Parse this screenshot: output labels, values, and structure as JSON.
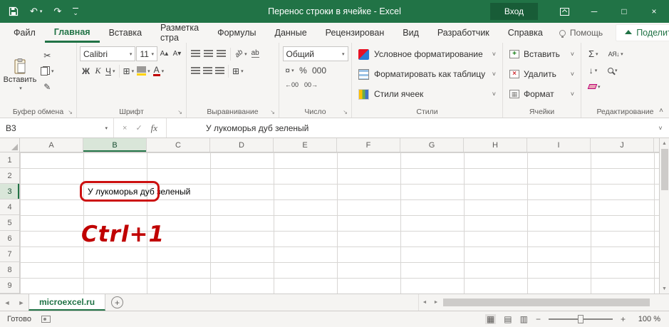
{
  "title_bar": {
    "title": "Перенос строки в ячейке  -  Excel",
    "sign_in": "Вход"
  },
  "icons": {
    "dropdown": "▾",
    "chevron": "˅",
    "collapse": "˄",
    "launcher": "↘",
    "undo": "↶",
    "redo": "↷",
    "qat_more": "⌄",
    "minimize": "─",
    "maximize": "□",
    "close": "×",
    "cut": "✂",
    "format_painter": "✎",
    "grow_font": "А▴",
    "shrink_font": "А▾",
    "borders": "⊞",
    "merge": "⊞",
    "currency": "¤",
    "inc_decimal": "←00",
    "dec_decimal": "00→",
    "orientation": "ab",
    "wrap_text": "ab",
    "font_color_letter": "А",
    "sigma": "Σ",
    "fill_down": "↓",
    "sort": "АЯ↓",
    "cancel": "×",
    "enter": "✓",
    "fx": "fx",
    "left_arrow": "◄",
    "right_arrow": "►",
    "up_arrow": "▲",
    "down_arrow": "▼",
    "view_normal": "▦",
    "view_layout": "▤",
    "view_break": "▥",
    "minus": "−",
    "plus": "+",
    "new_sheet": "+"
  },
  "ribbon": {
    "tabs": [
      "Файл",
      "Главная",
      "Вставка",
      "Разметка стра",
      "Формулы",
      "Данные",
      "Рецензирован",
      "Вид",
      "Разработчик",
      "Справка"
    ],
    "help_label": "Помощь",
    "share_label": "Поделиться",
    "clipboard": {
      "paste": "Вставить",
      "group": "Буфер обмена"
    },
    "font": {
      "name": "Calibri",
      "size": "11",
      "bold": "Ж",
      "italic": "К",
      "underline": "Ч",
      "group": "Шрифт"
    },
    "alignment": {
      "group": "Выравнивание"
    },
    "number": {
      "format": "Общий",
      "percent": "%",
      "thousands": "000",
      "group": "Число"
    },
    "styles": {
      "conditional": "Условное форматирование",
      "format_table": "Форматировать как таблицу",
      "cell_styles": "Стили ячеек",
      "group": "Стили"
    },
    "cells": {
      "insert": "Вставить",
      "delete": "Удалить",
      "format": "Формат",
      "group": "Ячейки"
    },
    "editing": {
      "group": "Редактирование"
    }
  },
  "formula_bar": {
    "name_box": "B3",
    "value": "У лукоморья дуб зеленый"
  },
  "grid": {
    "columns": [
      "A",
      "B",
      "C",
      "D",
      "E",
      "F",
      "G",
      "H",
      "I",
      "J"
    ],
    "rows": [
      "1",
      "2",
      "3",
      "4",
      "5",
      "6",
      "7",
      "8",
      "9"
    ],
    "b3_text": "У лукоморья дуб зеленый",
    "annotation": "Ctrl+1"
  },
  "sheet_bar": {
    "tab_label": "microexcel.ru"
  },
  "status_bar": {
    "ready": "Готово",
    "zoom": "100 %"
  }
}
